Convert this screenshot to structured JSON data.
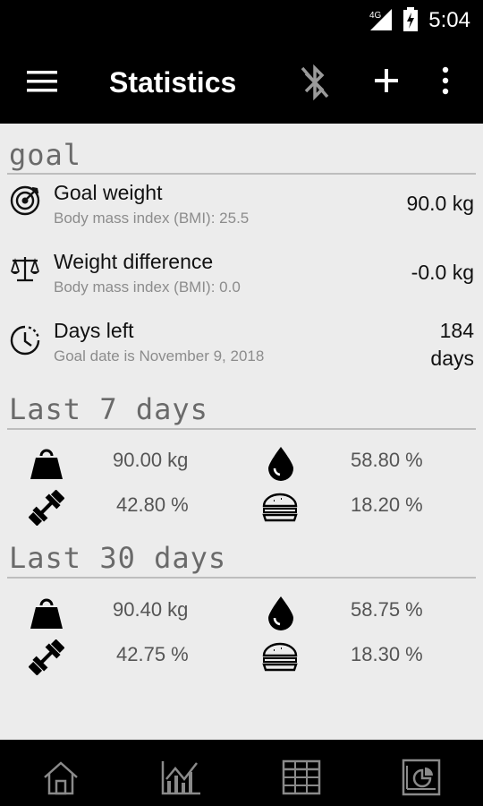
{
  "status_bar": {
    "network": "4G",
    "time": "5:04"
  },
  "app_bar": {
    "title": "Statistics",
    "icons": [
      "menu-icon",
      "bluetooth-disabled-icon",
      "add-icon",
      "more-vert-icon"
    ]
  },
  "goal": {
    "section_title": "goal",
    "rows": [
      {
        "icon": "target-icon",
        "title": "Goal weight",
        "subtitle": "Body mass index (BMI): 25.5",
        "value": "90.0 kg"
      },
      {
        "icon": "scale-icon",
        "title": "Weight difference",
        "subtitle": "Body mass index (BMI): 0.0",
        "value": "-0.0 kg"
      },
      {
        "icon": "clock-icon",
        "title": "Days left",
        "subtitle": "Goal date is November 9, 2018",
        "value_line1": "184",
        "value_line2": "days"
      }
    ]
  },
  "last7": {
    "section_title": "Last 7 days",
    "weight": "90.00 kg",
    "water": "58.80 %",
    "muscle": "42.80 %",
    "fat": "18.20 %"
  },
  "last30": {
    "section_title": "Last 30 days",
    "weight": "90.40 kg",
    "water": "58.75 %",
    "muscle": "42.75 %",
    "fat": "18.30 %"
  },
  "nav": {
    "items": [
      "home-icon",
      "chart-icon",
      "table-icon",
      "statistics-icon"
    ]
  }
}
